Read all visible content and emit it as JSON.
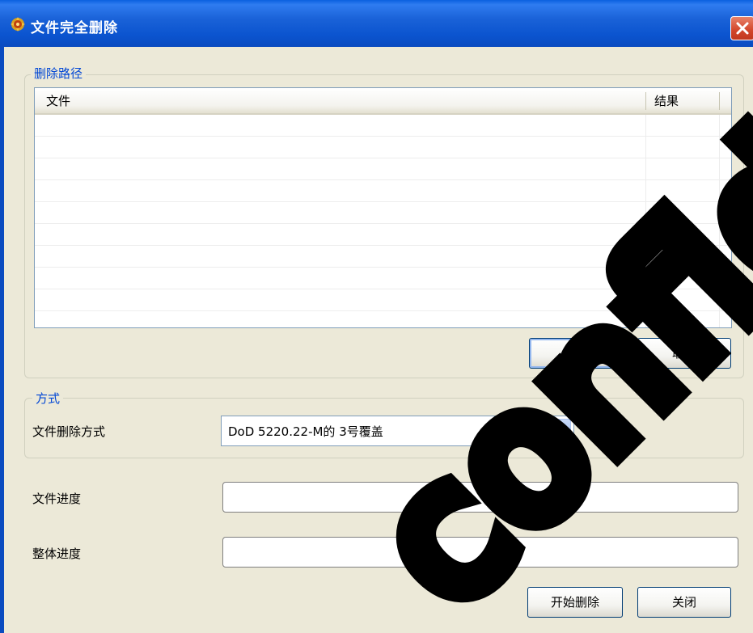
{
  "window": {
    "title": "文件完全删除",
    "icon": "gear-icon",
    "close_icon": "close-icon"
  },
  "path_group": {
    "label": "删除路径",
    "columns": [
      "文件",
      "结果"
    ],
    "rows": [],
    "add_button": "添加",
    "cancel_button": "取消"
  },
  "mode_group": {
    "label": "方式",
    "method_label": "文件删除方式",
    "method_value": "DoD 5220.22-M的 3号覆盖"
  },
  "progress": {
    "file_label": "文件进度",
    "file_value": 0,
    "overall_label": "整体进度",
    "overall_value": 0
  },
  "footer": {
    "start_button": "开始删除",
    "close_button": "关闭"
  },
  "watermark": {
    "text": "confidential"
  },
  "colors": {
    "titlebar": "#0b54cf",
    "dialog_bg": "#ece9d8",
    "group_label": "#0046d5",
    "close_red": "#d2452a",
    "watermark": "#000000"
  }
}
